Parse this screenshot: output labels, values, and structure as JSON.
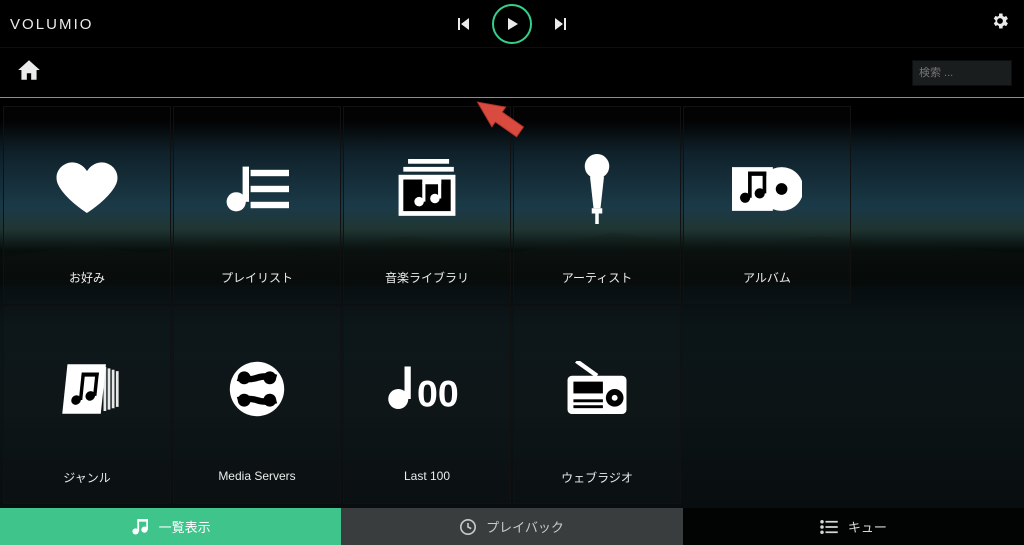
{
  "brand": "VOLUMIO",
  "search": {
    "placeholder": "検索 ..."
  },
  "tiles": [
    {
      "id": "favorites",
      "label": "お好み"
    },
    {
      "id": "playlists",
      "label": "プレイリスト"
    },
    {
      "id": "music-library",
      "label": "音楽ライブラリ"
    },
    {
      "id": "artists",
      "label": "アーティスト"
    },
    {
      "id": "albums",
      "label": "アルバム"
    },
    {
      "id": "genres",
      "label": "ジャンル"
    },
    {
      "id": "media-servers",
      "label": "Media Servers"
    },
    {
      "id": "last-100",
      "label": "Last 100"
    },
    {
      "id": "web-radio",
      "label": "ウェブラジオ"
    }
  ],
  "footer": {
    "browse": "一覧表示",
    "playback": "プレイバック",
    "queue": "キュー"
  },
  "colors": {
    "accent": "#3fc48c",
    "play_ring": "#35d18a"
  }
}
